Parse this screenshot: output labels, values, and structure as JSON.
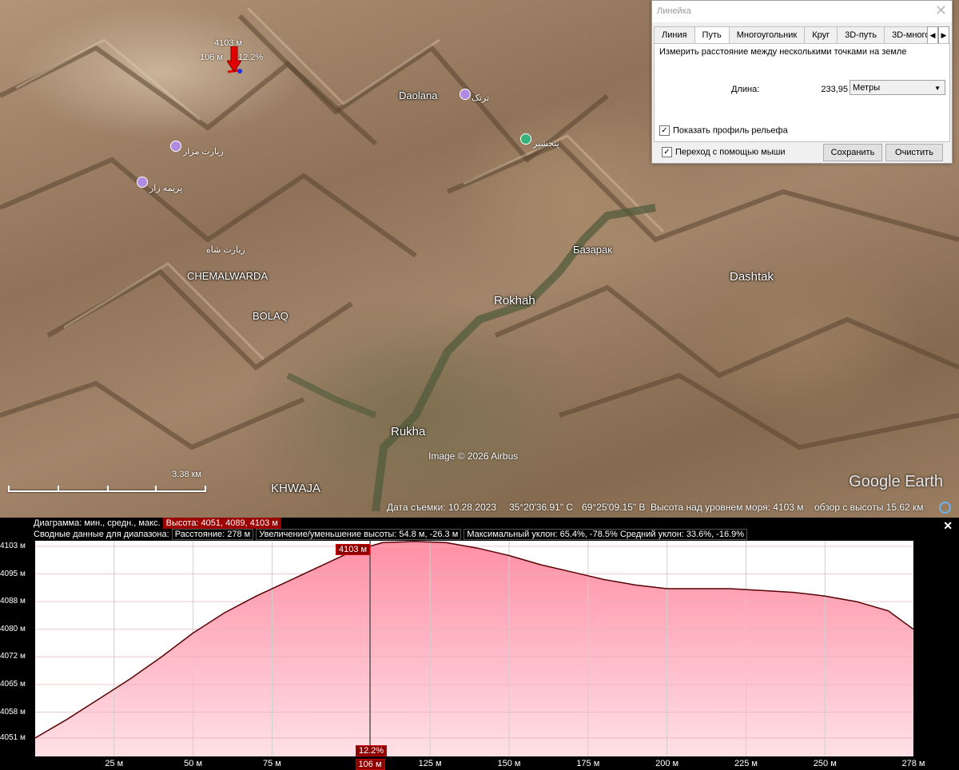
{
  "map": {
    "labels": {
      "daolana": "Daolana",
      "bazarak": "Базарак",
      "dashtak": "Dashtak",
      "rokhah": "Rokhah",
      "chemalwarda": "CHEMALWARDA",
      "bolaq": "BOLAQ",
      "rukha": "Rukha",
      "khwaja": "KHWAJA",
      "arabic_1": "ترتک",
      "arabic_2": "زیارت مزار",
      "arabic_3": "پریمه زار",
      "arabic_4": "زیارت شاه",
      "arabic_5": "پنجشیر"
    },
    "marker": {
      "elevation": "4103 м",
      "distance": "106 м",
      "grade": "12.2%"
    },
    "scale": "3.38 км",
    "copyright": "Image © 2026 Airbus",
    "logo": "Google Earth",
    "status": {
      "date": "Дата съемки: 10.28.2023",
      "lat": "35°20'36.91\" С",
      "lon": "69°25'09.15\" В",
      "elevation": "Высота над уровнем моря:  4103 м",
      "eye": "обзор с высоты  15.62 км"
    }
  },
  "ruler": {
    "title": "Линейка",
    "tabs": [
      "Линия",
      "Путь",
      "Многоугольник",
      "Круг",
      "3D-путь",
      "3D-много"
    ],
    "active_tab": "Путь",
    "description": "Измерить расстояние между несколькими точками на земле",
    "length_label": "Длина:",
    "length_value": "233,95",
    "units": "Метры",
    "show_profile": "Показать профиль рельефа",
    "mouse_nav": "Переход с помощью мыши",
    "save": "Сохранить",
    "clear": "Очистить"
  },
  "profile": {
    "row1_label": "Диаграмма: мин., средн., макс.",
    "row1_value": "Высота: 4051, 4089, 4103 м",
    "row2_label": "Сводные данные для диапазона:",
    "row2_distance": "Расстояние: 278 м",
    "row2_gain": "Увеличение/уменьшение высоты: 54.8 м, -26.3 м",
    "row2_slope": "Максимальный уклон: 65.4%, -78.5%  Средний уклон: 33.6%, -16.9%",
    "peak_label": "4103 м",
    "grade_label": "12.2%",
    "cursor_label": "106 м"
  },
  "chart_data": {
    "type": "area",
    "ylabels": [
      "4103 м",
      "4095 м",
      "4088 м",
      "4080 м",
      "4072 м",
      "4065 м",
      "4058 м",
      "4051 м"
    ],
    "yvalues": [
      4103,
      4095.5,
      4088,
      4080.5,
      4073,
      4065.5,
      4058,
      4051
    ],
    "xlabels": [
      "25 м",
      "50 м",
      "75 м",
      "106 м",
      "125 м",
      "150 м",
      "175 м",
      "200 м",
      "225 м",
      "250 м",
      "278 м"
    ],
    "xvalues": [
      25,
      50,
      75,
      106,
      125,
      150,
      175,
      200,
      225,
      250,
      278
    ],
    "xlim": [
      0,
      278
    ],
    "ylim": [
      4046,
      4104.5
    ],
    "cursor_x": 106,
    "x": [
      0,
      10,
      20,
      30,
      40,
      50,
      60,
      70,
      80,
      90,
      100,
      106,
      110,
      120,
      130,
      140,
      150,
      160,
      170,
      180,
      190,
      200,
      210,
      220,
      230,
      240,
      250,
      260,
      270,
      278
    ],
    "y": [
      4051,
      4056,
      4061.5,
      4067,
      4073,
      4079.5,
      4085,
      4089.5,
      4093.5,
      4097.5,
      4101.5,
      4103,
      4104,
      4104.3,
      4104,
      4102.5,
      4100.5,
      4098,
      4096,
      4094,
      4092.5,
      4091.5,
      4091.5,
      4091.5,
      4091,
      4090.5,
      4089.5,
      4088,
      4085.5,
      4080.5
    ],
    "color": "#ff9db0",
    "line_color": "#5a0000",
    "grid": true
  }
}
